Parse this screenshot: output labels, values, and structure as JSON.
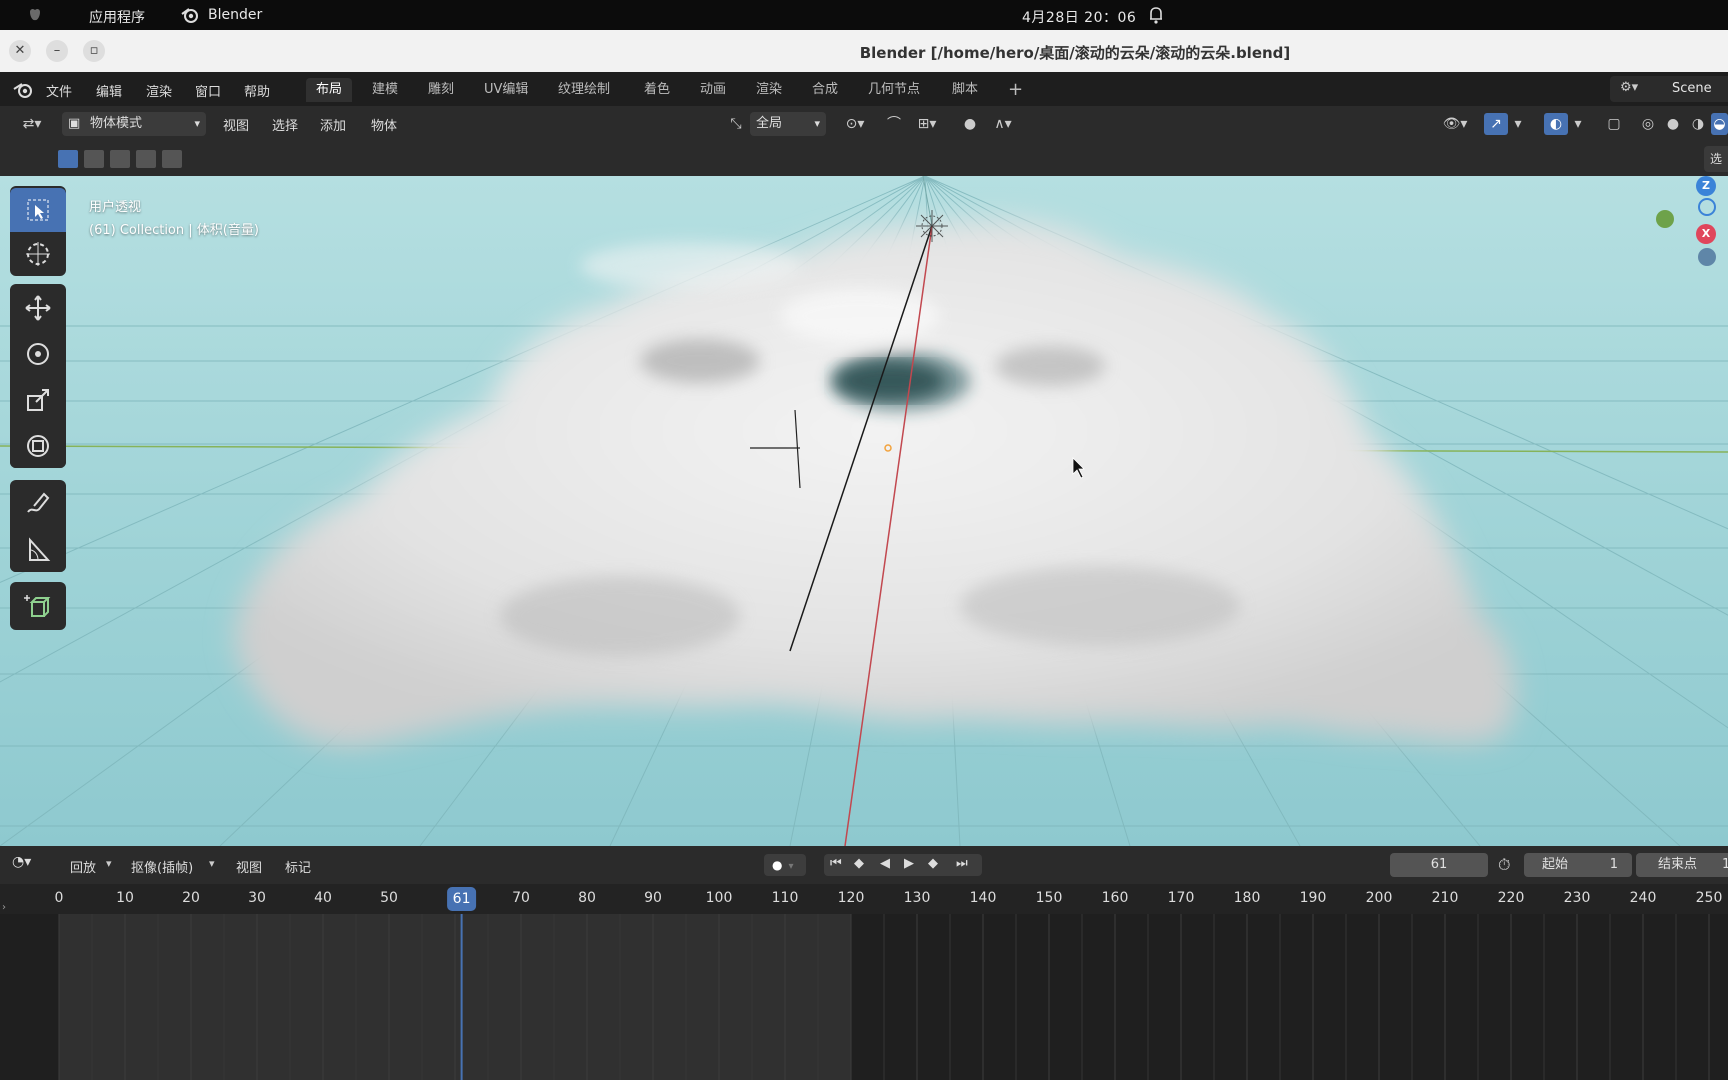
{
  "topbar": {
    "applications": "应用程序",
    "app_name": "Blender",
    "clock": "4月28日 20：06"
  },
  "window": {
    "title": "Blender [/home/hero/桌面/滚动的云朵/滚动的云朵.blend]"
  },
  "menu": {
    "items": [
      "文件",
      "编辑",
      "渲染",
      "窗口",
      "帮助"
    ],
    "workspaces": [
      "布局",
      "建模",
      "雕刻",
      "UV编辑",
      "纹理绘制",
      "着色",
      "动画",
      "渲染",
      "合成",
      "几何节点",
      "脚本"
    ],
    "active_workspace": "布局",
    "add_tab": "+",
    "scene": "Scene"
  },
  "viewport_header": {
    "mode": "物体模式",
    "menus": [
      "视图",
      "选择",
      "添加",
      "物体"
    ],
    "transform_orientation": "全局",
    "sidebar_tab": "选"
  },
  "viewport": {
    "view_name": "用户透视",
    "collection_info": "(61) Collection | 体积(音量)",
    "gizmo": {
      "z": "Z",
      "x": "X"
    },
    "colors": {
      "x_axis": "#e0465c",
      "z_axis": "#3b83d8",
      "y_axis": "#6ea24a",
      "background": "#9dd2d6"
    }
  },
  "timeline": {
    "playback": "回放",
    "keying": "抠像(插帧)",
    "view": "视图",
    "marker": "标记",
    "current_frame": "61",
    "start_label": "起始",
    "start_value": "1",
    "end_label": "结束点",
    "end_value": "1",
    "ruler_labels": [
      "0",
      "10",
      "20",
      "30",
      "40",
      "50",
      "70",
      "80",
      "90",
      "100",
      "110",
      "120",
      "130",
      "140",
      "150",
      "160",
      "170",
      "180",
      "190",
      "200",
      "210",
      "220",
      "230",
      "240",
      "250"
    ],
    "ruler_frames": [
      0,
      10,
      20,
      30,
      40,
      50,
      70,
      80,
      90,
      100,
      110,
      120,
      130,
      140,
      150,
      160,
      170,
      180,
      190,
      200,
      210,
      220,
      230,
      240,
      250
    ],
    "playhead_label": "61",
    "frame_range_end": 120
  }
}
